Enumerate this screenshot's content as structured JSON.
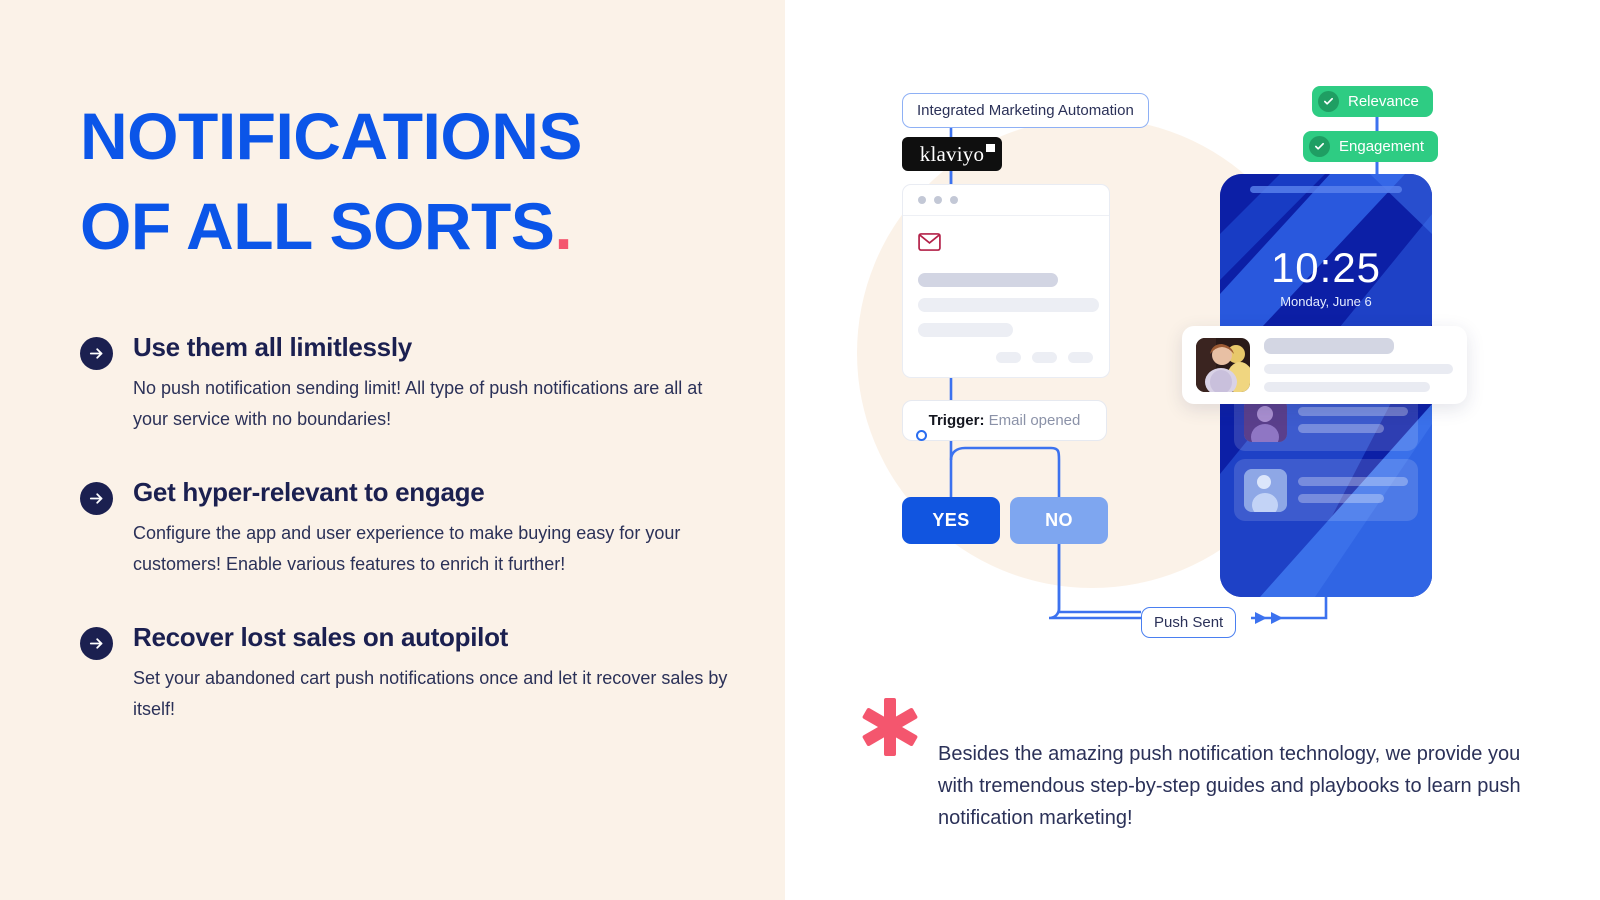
{
  "left": {
    "headline_line1": "NOTIFICATIONS",
    "headline_line2": "OF ALL SORTS",
    "headline_dot": ".",
    "features": [
      {
        "icon": "arrow-right-circle-icon",
        "title": "Use them all limitlessly",
        "desc": "No push notification sending limit! All type of push notifications are all at your service with no boundaries!"
      },
      {
        "icon": "arrow-right-circle-icon",
        "title": "Get hyper-relevant to engage",
        "desc": "Configure the app and user experience to make buying easy for your customers! Enable various features to enrich it further!"
      },
      {
        "icon": "arrow-right-circle-icon",
        "title": "Recover lost sales on autopilot",
        "desc": "Set your abandoned cart push notifications once and let it recover sales by itself!"
      }
    ]
  },
  "right": {
    "flow": {
      "integration_label": "Integrated Marketing Automation",
      "brand_logo_text": "klaviyo",
      "trigger_label": "Trigger:",
      "trigger_value": "Email opened",
      "yes_button": "YES",
      "no_button": "NO",
      "push_sent_label": "Push Sent",
      "email_icon": "envelope-icon"
    },
    "badges": [
      {
        "label": "Relevance",
        "icon": "check-circle-icon",
        "color": "#2ecc83"
      },
      {
        "label": "Engagement",
        "icon": "check-circle-icon",
        "color": "#2ecc83"
      }
    ],
    "phone": {
      "time": "10:25",
      "date": "Monday, June 6"
    },
    "note": {
      "icon": "asterisk-icon",
      "text": "Besides the amazing push notification technology, we provide you with tremendous step-by-step guides and playbooks to learn push notification marketing!"
    }
  },
  "colors": {
    "cream": "#fbf2e8",
    "brand_blue": "#0b55e8",
    "navy": "#1b2050",
    "accent_pink": "#f4566e",
    "green": "#2ecc83",
    "yes_blue": "#1155e0",
    "no_blue": "#7ea6f0"
  }
}
